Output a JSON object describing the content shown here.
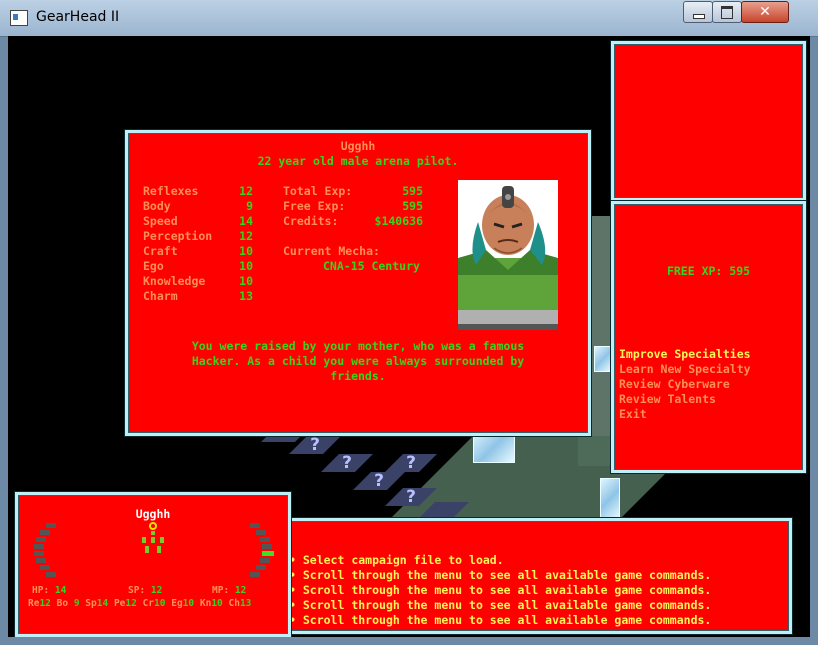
{
  "window": {
    "title": "GearHead II"
  },
  "character": {
    "name": "Ugghh",
    "description": "22 year old male arena pilot.",
    "stats": [
      {
        "label": "Reflexes",
        "value": "12"
      },
      {
        "label": "Body",
        "value": "9"
      },
      {
        "label": "Speed",
        "value": "14"
      },
      {
        "label": "Perception",
        "value": "12"
      },
      {
        "label": "Craft",
        "value": "10"
      },
      {
        "label": "Ego",
        "value": "10"
      },
      {
        "label": "Knowledge",
        "value": "10"
      },
      {
        "label": "Charm",
        "value": "13"
      }
    ],
    "totals": [
      {
        "label": "Total Exp:",
        "value": "595"
      },
      {
        "label": "Free Exp:",
        "value": "595"
      },
      {
        "label": "Credits:",
        "value": "$140636"
      }
    ],
    "mecha_label": "Current Mecha:",
    "mecha_value": "CNA-15 Century",
    "bio": [
      "You were raised by your mother, who was a famous",
      "Hacker. As a child you were always surrounded by",
      "friends."
    ]
  },
  "menu": {
    "free_xp": "FREE XP: 595",
    "items": [
      {
        "label": "Improve Specialties"
      },
      {
        "label": "Learn New Specialty"
      },
      {
        "label": "Review Cyberware"
      },
      {
        "label": "Review Talents"
      },
      {
        "label": "Exit"
      }
    ]
  },
  "status": {
    "name": "Ugghh",
    "hp_label": "HP:",
    "hp": "14",
    "sp_label": "SP:",
    "sp": "12",
    "mp_label": "MP:",
    "mp": "12",
    "stats_line": [
      {
        "label": "Re",
        "value": "12"
      },
      {
        "label": "Bo",
        "value": "9"
      },
      {
        "label": "Sp",
        "value": "14"
      },
      {
        "label": "Pe",
        "value": "12"
      },
      {
        "label": "Cr",
        "value": "10"
      },
      {
        "label": "Eg",
        "value": "10"
      },
      {
        "label": "Kn",
        "value": "10"
      },
      {
        "label": "Ch",
        "value": "13"
      }
    ]
  },
  "messages": [
    "Select campaign file to load.",
    "Scroll through the menu to see all available game commands.",
    "Scroll through the menu to see all available game commands.",
    "Scroll through the menu to see all available game commands.",
    "Scroll through the menu to see all available game commands."
  ],
  "map": {
    "unknown_tile_glyph": "?"
  },
  "colors": {
    "panel": "#ff0000",
    "border": "#bff0f8",
    "stat_text": "#39d41b",
    "menu_selected": "#fff35a",
    "menu_text": "#ff8e55"
  }
}
